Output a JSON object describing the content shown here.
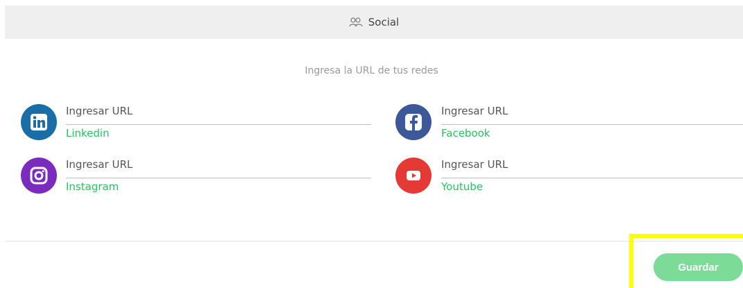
{
  "header": {
    "title": "Social",
    "icon": "users-icon"
  },
  "subtitle": "Ingresa la URL de tus redes",
  "networks": [
    {
      "name": "Linkedin",
      "placeholder": "Ingresar URL",
      "icon": "linkedin-icon",
      "color": "#1a6da6"
    },
    {
      "name": "Facebook",
      "placeholder": "Ingresar URL",
      "icon": "facebook-icon",
      "color": "#3b5998"
    },
    {
      "name": "Instagram",
      "placeholder": "Ingresar URL",
      "icon": "instagram-icon",
      "color": "#7b2cbf"
    },
    {
      "name": "Youtube",
      "placeholder": "Ingresar URL",
      "icon": "youtube-icon",
      "color": "#e53935"
    }
  ],
  "actions": {
    "save_label": "Guardar"
  },
  "colors": {
    "accent": "#22c55e",
    "button": "#7bdb97",
    "highlight": "#ffff00"
  }
}
